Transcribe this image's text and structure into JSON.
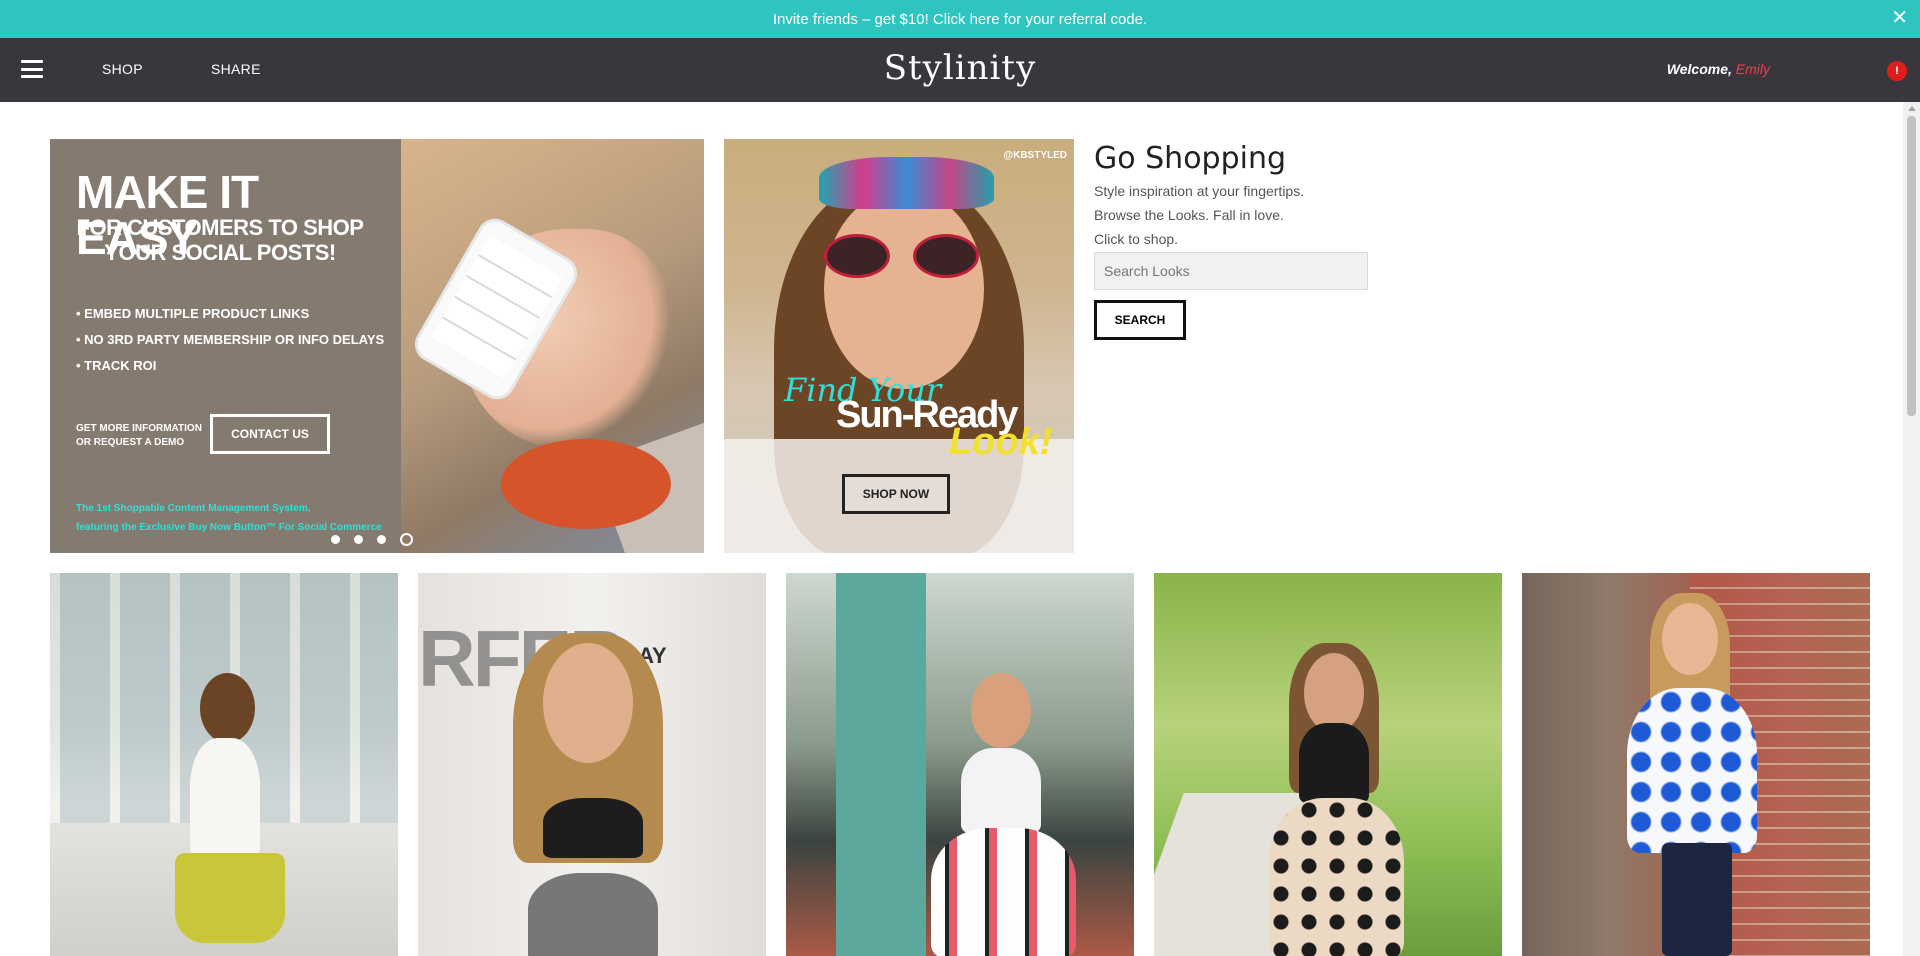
{
  "referral": {
    "text": "Invite friends – get $10! Click here for your referral code.",
    "close": "✕"
  },
  "nav": {
    "shop": "SHOP",
    "share": "SHARE",
    "logo": "Stylinity",
    "welcome": "Welcome,",
    "user": "Emily",
    "notification_count": "!"
  },
  "hero": {
    "headline": "MAKE IT EASY",
    "subheadline_1": "FOR CUSTOMERS TO SHOP",
    "subheadline_2": "YOUR SOCIAL POSTS!",
    "bullets": [
      "• EMBED MULTIPLE PRODUCT LINKS",
      "• NO 3RD PARTY MEMBERSHIP OR INFO DELAYS",
      "• TRACK ROI"
    ],
    "cta_text_1": "GET MORE INFORMATION",
    "cta_text_2": "OR REQUEST A DEMO",
    "cta_button": "CONTACT US",
    "tagline_1": "The 1st Shoppable Content Management System,",
    "tagline_2": "featuring the Exclusive Buy Now Button™ For Social Commerce"
  },
  "promo": {
    "handle": "@KBSTYLED",
    "find": "Find Your",
    "sun_ready": "Sun-Ready",
    "look": "Look!",
    "button": "SHOP NOW"
  },
  "go_shopping": {
    "title": "Go Shopping",
    "line1": "Style inspiration at your fingertips.",
    "line2": "Browse the Looks. Fall in love.",
    "line3": "Click to shop.",
    "search_placeholder": "Search Looks",
    "search_button": "SEARCH"
  },
  "tiles": {
    "t2_word": "RFER",
    "t2_bay": "LE BAY"
  },
  "colors": {
    "teal": "#2ec4c0",
    "nav_bg": "#3a363d",
    "accent_red": "#e8404a",
    "tagline_cyan": "#2ee0d8"
  },
  "icons": {
    "menu": "hamburger-icon",
    "close": "close-icon",
    "notification": "notification-icon"
  }
}
